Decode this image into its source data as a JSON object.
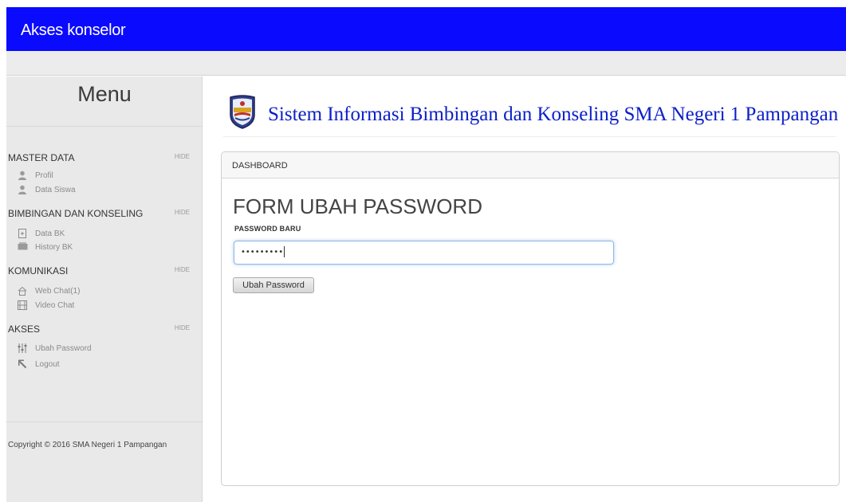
{
  "topbar": {
    "title": "Akses konselor"
  },
  "sidebar": {
    "title": "Menu",
    "sections": [
      {
        "label": "MASTER DATA",
        "hide": "HIDE",
        "items": [
          {
            "label": "Profil",
            "icon": "user-icon"
          },
          {
            "label": "Data Siswa",
            "icon": "user-icon"
          }
        ]
      },
      {
        "label": "BIMBINGAN DAN KONSELING",
        "hide": "HIDE",
        "items": [
          {
            "label": "Data BK",
            "icon": "add-file-icon"
          },
          {
            "label": "History BK",
            "icon": "inbox-icon"
          }
        ]
      },
      {
        "label": "KOMUNIKASI",
        "hide": "HIDE",
        "items": [
          {
            "label": "Web Chat(1)",
            "icon": "home-icon"
          },
          {
            "label": "Video Chat",
            "icon": "film-icon"
          }
        ]
      },
      {
        "label": "AKSES",
        "hide": "HIDE",
        "items": [
          {
            "label": "Ubah Password",
            "icon": "sliders-icon"
          },
          {
            "label": "Logout",
            "icon": "arrow-icon"
          }
        ]
      }
    ],
    "copyright": "Copyright © 2016 SMA Negeri 1 Pampangan"
  },
  "header": {
    "site_title": "Sistem Informasi Bimbingan dan Konseling SMA Negeri 1 Pampangan"
  },
  "panel": {
    "breadcrumb": "DASHBOARD",
    "form_title": "FORM UBAH PASSWORD",
    "field_label": "PASSWORD BARU",
    "password_value": "•••••••••",
    "button_label": "Ubah Password"
  },
  "colors": {
    "topbar": "#0a0aff",
    "title": "#0d20c8",
    "sidebar": "#e9e9e9"
  }
}
